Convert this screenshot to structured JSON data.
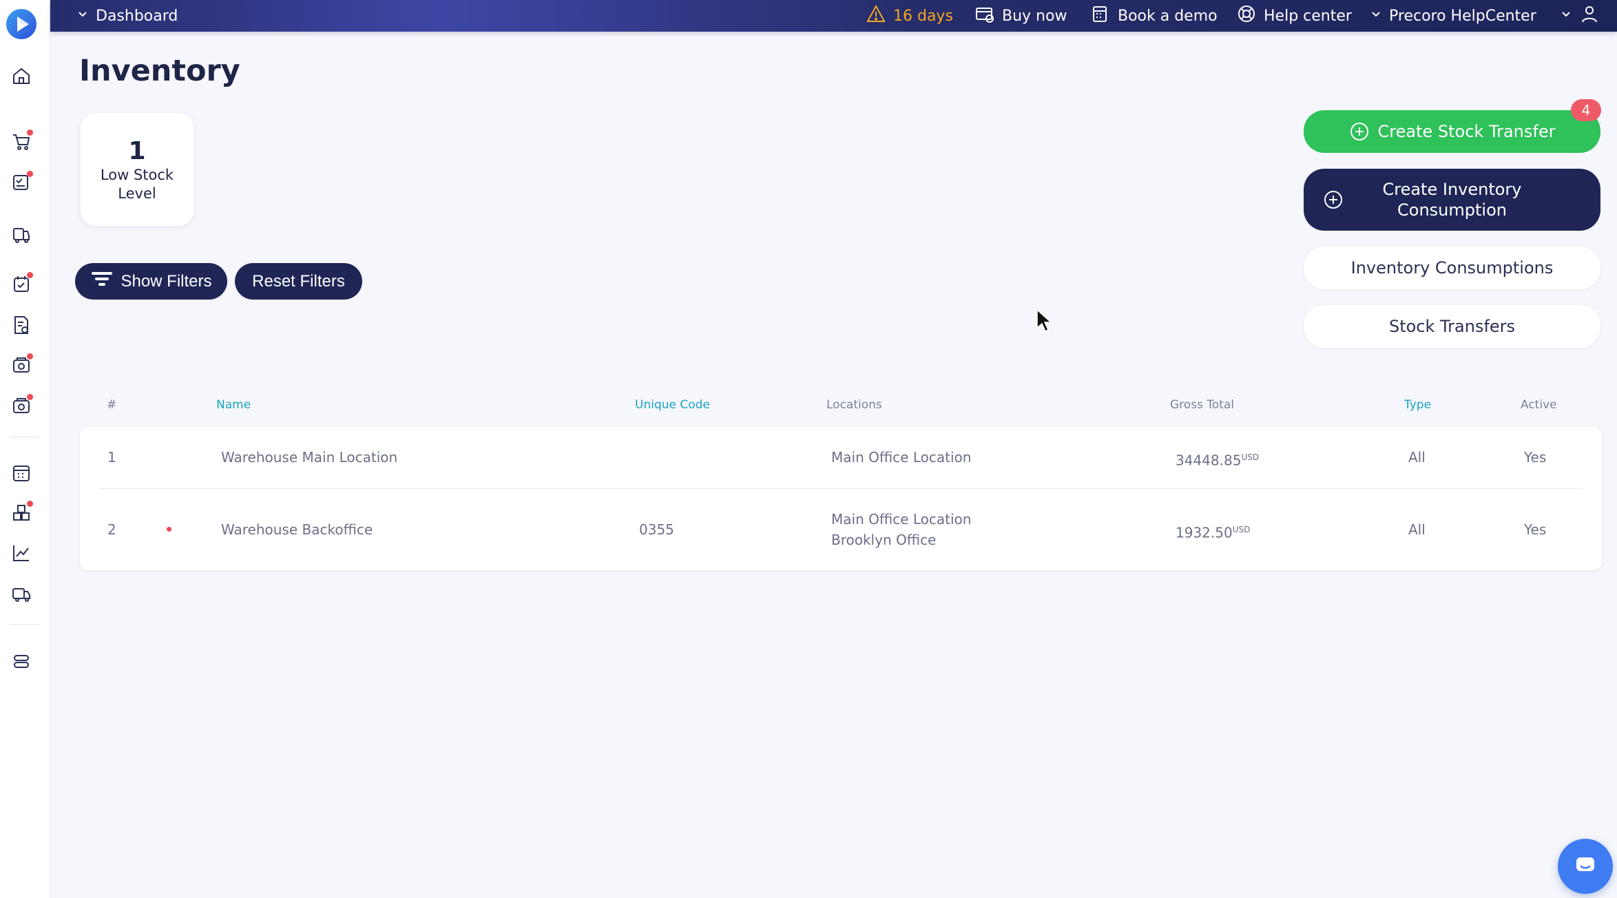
{
  "topbar": {
    "dashboard": "Dashboard",
    "trial": "16 days",
    "buy_now": "Buy now",
    "book_demo": "Book a demo",
    "help_center": "Help center",
    "account": "Precoro HelpCenter"
  },
  "page": {
    "title": "Inventory"
  },
  "stat": {
    "value": "1",
    "label": "Low Stock Level"
  },
  "filters": {
    "show": "Show Filters",
    "reset": "Reset Filters"
  },
  "actions": {
    "create_stock_transfer": "Create Stock Transfer",
    "badge": "4",
    "create_inventory_consumption": "Create Inventory Consumption",
    "inventory_consumptions": "Inventory Consumptions",
    "stock_transfers": "Stock Transfers"
  },
  "table": {
    "headers": {
      "num": "#",
      "name": "Name",
      "unique_code": "Unique Code",
      "locations": "Locations",
      "gross_total": "Gross Total",
      "type": "Type",
      "active": "Active"
    },
    "rows": [
      {
        "num": "1",
        "name": "Warehouse Main Location",
        "unique_code": "",
        "location_1": "Main Office Location",
        "location_2": "",
        "gross_total": "34448.85",
        "currency": "USD",
        "type": "All",
        "active": "Yes"
      },
      {
        "num": "2",
        "name": "Warehouse Backoffice",
        "unique_code": "0355",
        "location_1": "Main Office Location",
        "location_2": "Brooklyn Office",
        "gross_total": "1932.50",
        "currency": "USD",
        "type": "All",
        "active": "Yes"
      }
    ]
  },
  "colors": {
    "accent_green": "#2fc15a",
    "navy": "#1f2656",
    "link": "#1aa3c2",
    "warning": "#f5a623",
    "badge": "#ef5a68"
  }
}
